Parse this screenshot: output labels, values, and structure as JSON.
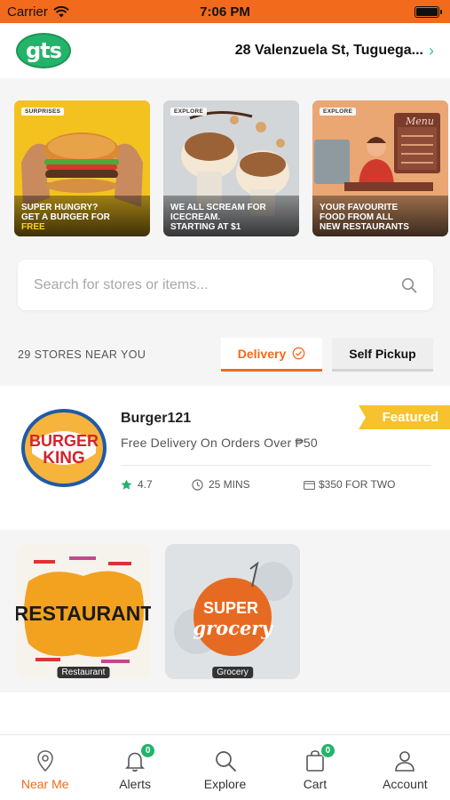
{
  "status_bar": {
    "carrier": "Carrier",
    "time": "7:06 PM"
  },
  "header": {
    "logo_text": "gts",
    "address": "28 Valenzuela St, Tuguega..."
  },
  "banners": [
    {
      "tag": "SURPRISES",
      "line1": "SUPER HUNGRY?",
      "line2": "GET A BURGER FOR",
      "line3": "FREE"
    },
    {
      "tag": "EXPLORE",
      "line1": "WE ALL SCREAM FOR",
      "line2": "ICECREAM.",
      "line3": "STARTING AT $1"
    },
    {
      "tag": "EXPLORE",
      "line1": "YOUR FAVOURITE",
      "line2": "FOOD FROM ALL",
      "line3": "NEW RESTAURANTS",
      "sign": "Menu"
    }
  ],
  "search": {
    "placeholder": "Search for stores or items..."
  },
  "stores": {
    "count_label": "29 STORES NEAR YOU"
  },
  "delivery_tabs": {
    "delivery": "Delivery",
    "self_pickup": "Self Pickup"
  },
  "store_card": {
    "logo_line1": "BURGER",
    "logo_line2": "KING",
    "name": "Burger121",
    "promo": "Free Delivery On Orders Over ₱50",
    "rating": "4.7",
    "time": "25 MINS",
    "price": "$350 FOR TWO",
    "badge": "Featured"
  },
  "categories": [
    {
      "label": "Restaurant",
      "art_text": "RESTAURANT"
    },
    {
      "label": "Grocery",
      "art_line1": "SUPER",
      "art_line2": "grocery"
    }
  ],
  "tab_bar": {
    "near_me": "Near Me",
    "alerts": "Alerts",
    "alerts_badge": "0",
    "explore": "Explore",
    "cart": "Cart",
    "cart_badge": "0",
    "account": "Account"
  },
  "colors": {
    "accent": "#f26a1b",
    "brand_green": "#24b36b",
    "featured_yellow": "#f6c22d"
  }
}
